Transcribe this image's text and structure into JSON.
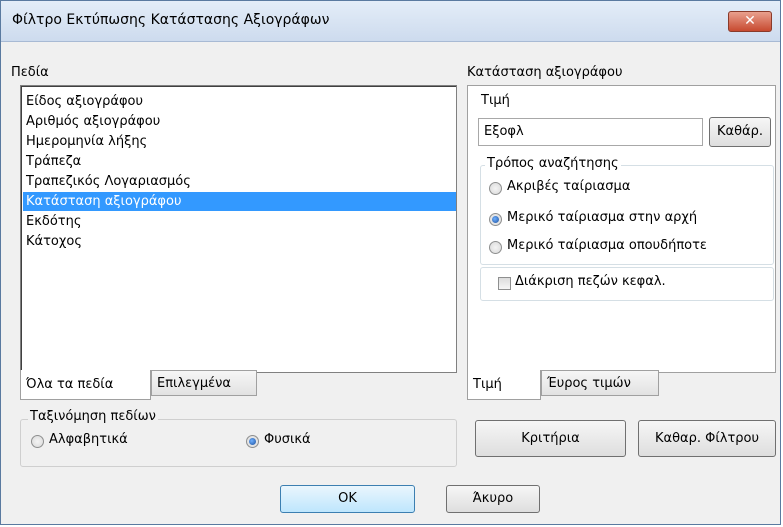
{
  "window": {
    "title": "Φίλτρο Εκτύπωσης Κατάστασης Αξιογράφων",
    "close_label": "✕"
  },
  "fields": {
    "label": "Πεδία",
    "items": [
      "Είδος αξιογράφου",
      "Αριθμός αξιογράφου",
      "Ημερομηνία λήξης",
      "Τράπεζα",
      "Τραπεζικός Λογαριασμός",
      "Κατάσταση αξιογράφου",
      "Εκδότης",
      "Κάτοχος"
    ],
    "selected_index": 5,
    "tabs": [
      "Όλα τα πεδία",
      "Επιλεγμένα"
    ]
  },
  "right_panel": {
    "label": "Κατάσταση αξιογράφου",
    "value_label": "Τιμή",
    "value": "Εξοφλ",
    "clear_button": "Καθάρ.",
    "search_mode": {
      "legend": "Τρόπος αναζήτησης",
      "options": [
        "Ακριβές ταίριασμα",
        "Μερικό ταίριασμα στην αρχή",
        "Μερικό ταίριασμα οπουδήποτε"
      ],
      "selected_index": 1
    },
    "case_sensitive_label": "Διάκριση πεζών κεφαλ.",
    "case_sensitive_checked": false,
    "tabs": [
      "Τιμή",
      "Έυρος τιμών"
    ]
  },
  "sorting": {
    "legend": "Ταξινόμηση πεδίων",
    "options": [
      "Αλφαβητικά",
      "Φυσικά"
    ],
    "selected_index": 1
  },
  "buttons": {
    "criteria": "Κριτήρια",
    "clear_filter": "Καθαρ. Φίλτρου",
    "ok": "OK",
    "cancel": "Άκυρο"
  }
}
